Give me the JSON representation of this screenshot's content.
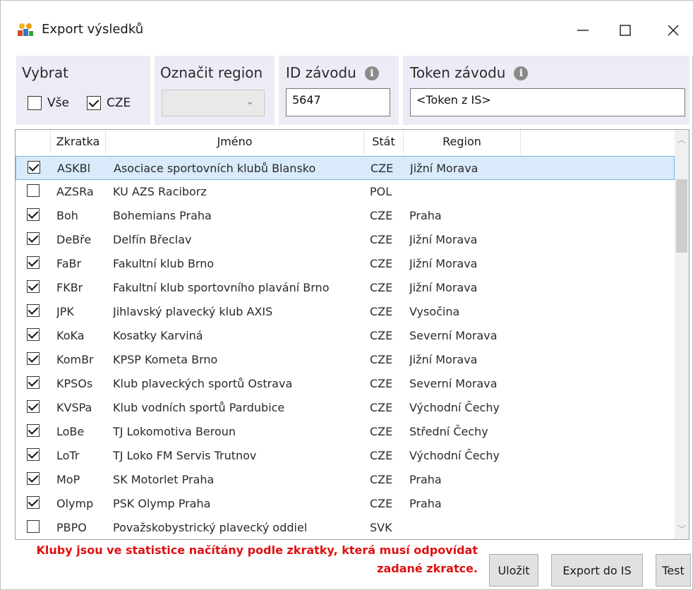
{
  "window": {
    "title": "Export výsledků"
  },
  "filters": {
    "select_label": "Vybrat",
    "all_label": "Vše",
    "cze_label": "CZE",
    "all_checked": false,
    "cze_checked": true,
    "region_label": "Označit region",
    "region_value": "",
    "race_id_label": "ID závodu",
    "race_id_value": "5647",
    "token_label": "Token závodu",
    "token_value": "<Token z IS>"
  },
  "table": {
    "columns": [
      "Zkratka",
      "Jméno",
      "Stát",
      "Region"
    ],
    "rows": [
      {
        "checked": true,
        "abbr": "ASKBl",
        "name": "Asociace sportovních klubů Blansko",
        "country": "CZE",
        "region": "Jižní Morava",
        "selected": true
      },
      {
        "checked": false,
        "abbr": "AZSRa",
        "name": "KU AZS Raciborz",
        "country": "POL",
        "region": ""
      },
      {
        "checked": true,
        "abbr": "Boh",
        "name": "Bohemians Praha",
        "country": "CZE",
        "region": "Praha"
      },
      {
        "checked": true,
        "abbr": "DeBře",
        "name": "Delfín Břeclav",
        "country": "CZE",
        "region": "Jižní Morava"
      },
      {
        "checked": true,
        "abbr": "FaBr",
        "name": "Fakultní klub Brno",
        "country": "CZE",
        "region": "Jižní Morava"
      },
      {
        "checked": true,
        "abbr": "FKBr",
        "name": "Fakultní klub sportovního plavání Brno",
        "country": "CZE",
        "region": "Jižní Morava"
      },
      {
        "checked": true,
        "abbr": "JPK",
        "name": "Jihlavský plavecký klub AXIS",
        "country": "CZE",
        "region": "Vysočina"
      },
      {
        "checked": true,
        "abbr": "KoKa",
        "name": "Kosatky Karviná",
        "country": "CZE",
        "region": "Severní Morava"
      },
      {
        "checked": true,
        "abbr": "KomBr",
        "name": "KPSP Kometa Brno",
        "country": "CZE",
        "region": "Jižní Morava"
      },
      {
        "checked": true,
        "abbr": "KPSOs",
        "name": "Klub plaveckých sportů Ostrava",
        "country": "CZE",
        "region": "Severní Morava"
      },
      {
        "checked": true,
        "abbr": "KVSPa",
        "name": "Klub vodních sportů Pardubice",
        "country": "CZE",
        "region": "Východní Čechy"
      },
      {
        "checked": true,
        "abbr": "LoBe",
        "name": "TJ Lokomotiva Beroun",
        "country": "CZE",
        "region": "Střední Čechy"
      },
      {
        "checked": true,
        "abbr": "LoTr",
        "name": "TJ Loko FM Servis Trutnov",
        "country": "CZE",
        "region": "Východní Čechy"
      },
      {
        "checked": true,
        "abbr": "MoP",
        "name": "SK Motorlet Praha",
        "country": "CZE",
        "region": "Praha"
      },
      {
        "checked": true,
        "abbr": "Olymp",
        "name": "PSK Olymp Praha",
        "country": "CZE",
        "region": "Praha"
      },
      {
        "checked": false,
        "abbr": "PBPO",
        "name": "Považskobystrický plavecký oddiel",
        "country": "SVK",
        "region": ""
      }
    ]
  },
  "footer": {
    "message_line1": "Kluby jsou ve statistice načítány podle zkratky, která musí odpovídat",
    "message_line2": "zadané zkratce.",
    "save_label": "Uložit",
    "export_label": "Export do IS",
    "test_label": "Test"
  },
  "colors": {
    "warning_text": "#e01010",
    "panel_bg": "#ececf6",
    "selected_row": "#d9ebfa"
  }
}
